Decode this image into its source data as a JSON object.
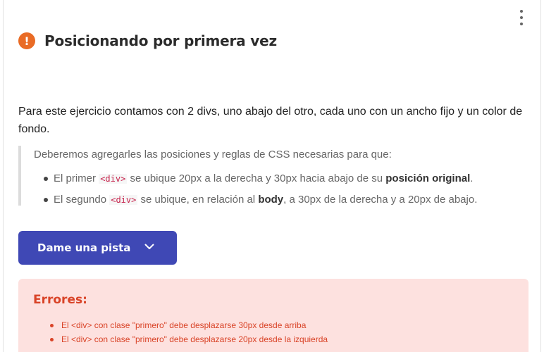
{
  "header": {
    "title": "Posicionando por primera vez",
    "alert_icon": "!"
  },
  "intro": "Para este ejercicio contamos con 2 divs, uno abajo del otro, cada uno con un ancho fijo y un color de fondo.",
  "quote": {
    "lead": "Deberemos agregarles las posiciones y reglas de CSS necesarias para que:",
    "items": [
      {
        "before": "El primer ",
        "code": "<div>",
        "middle": " se ubique 20px a la derecha y 30px hacia abajo de su ",
        "bold": "posición original",
        "after": "."
      },
      {
        "before": "El segundo ",
        "code": "<div>",
        "middle": " se ubique, en relación al ",
        "bold": "body",
        "after": ", a 30px de la derecha y a 20px de abajo."
      }
    ]
  },
  "hint_button": {
    "label": "Dame una pista",
    "icon": "chevron-down-icon"
  },
  "errors": {
    "title": "Errores:",
    "items": [
      "El <div> con clase \"primero\" debe desplazarse 30px desde arriba",
      "El <div> con clase \"primero\" debe desplazarse 20px desde la izquierda"
    ]
  },
  "colors": {
    "accent": "#3f48b5",
    "alert": "#e96b25",
    "error_text": "#d94327",
    "error_bg": "#fde1df"
  }
}
